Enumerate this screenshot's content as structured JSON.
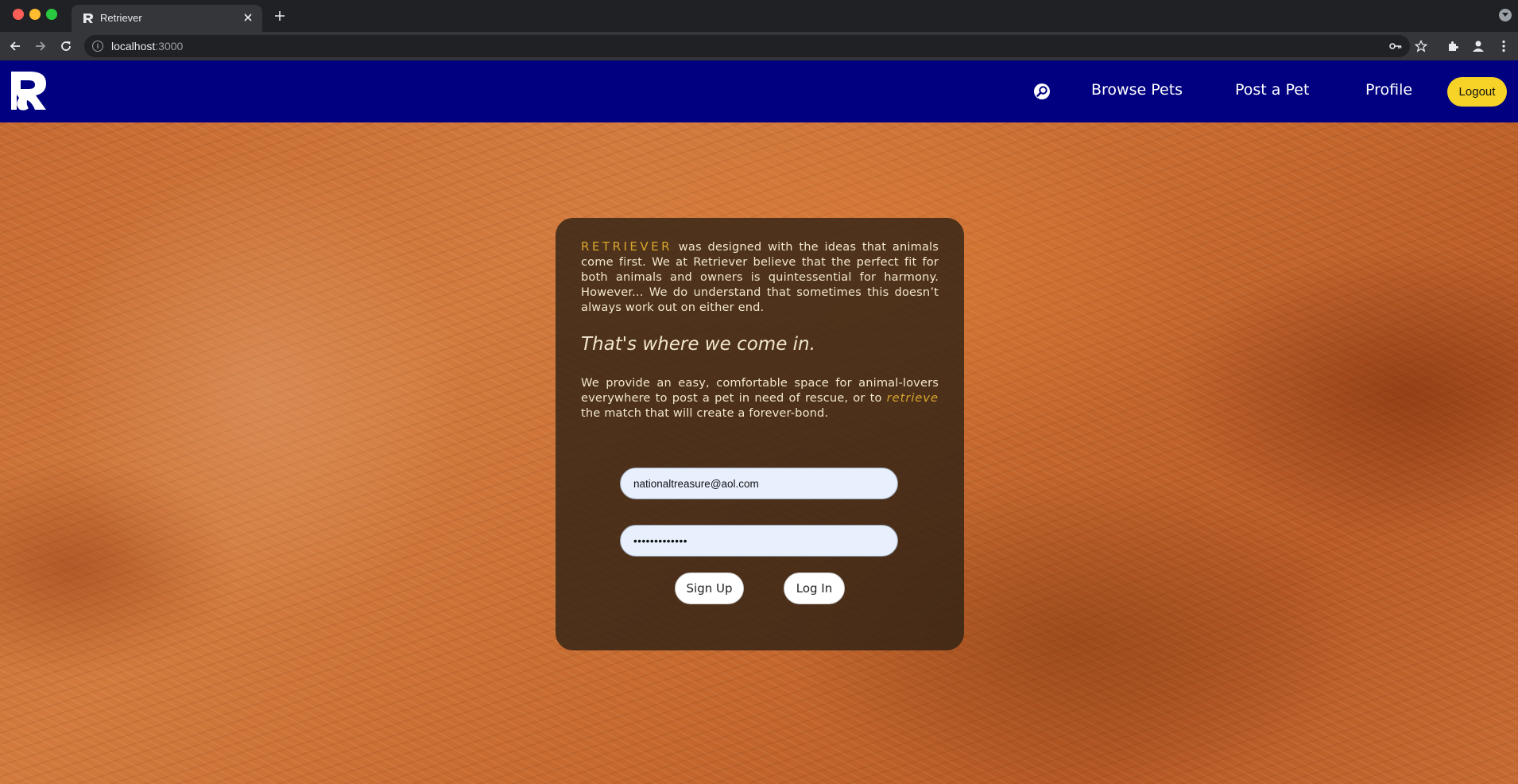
{
  "browser": {
    "tab_title": "Retriever",
    "url_host": "localhost",
    "url_port": ":3000"
  },
  "nav": {
    "links": [
      "Browse Pets",
      "Post a Pet",
      "Profile"
    ],
    "logout_label": "Logout",
    "icons": [
      "search-icon"
    ]
  },
  "card": {
    "brand_word": "RETRIEVER",
    "intro_text": " was designed with the ideas that animals come first. We at Retriever believe that the perfect fit for both animals and owners is quintessential for harmony. However... We do understand that sometimes this doesn’t always work out on either end.",
    "tagline": "That's where we come in.",
    "body_before": "We provide an easy, comfortable space for animal-lovers everywhere to post a pet in need of rescue, or to ",
    "body_highlight": "retrieve",
    "body_after": " the match that will create a forever-bond.",
    "email_value": "nationaltreasure@aol.com",
    "password_value": "•••••••••••••",
    "signup_label": "Sign Up",
    "login_label": "Log In"
  },
  "colors": {
    "navbar": "#000080",
    "logout_button": "#f6d326",
    "accent_text": "#d9a62c",
    "card_background": "rgba(45,33,20,0.80)",
    "input_background": "#e8f0fe"
  }
}
